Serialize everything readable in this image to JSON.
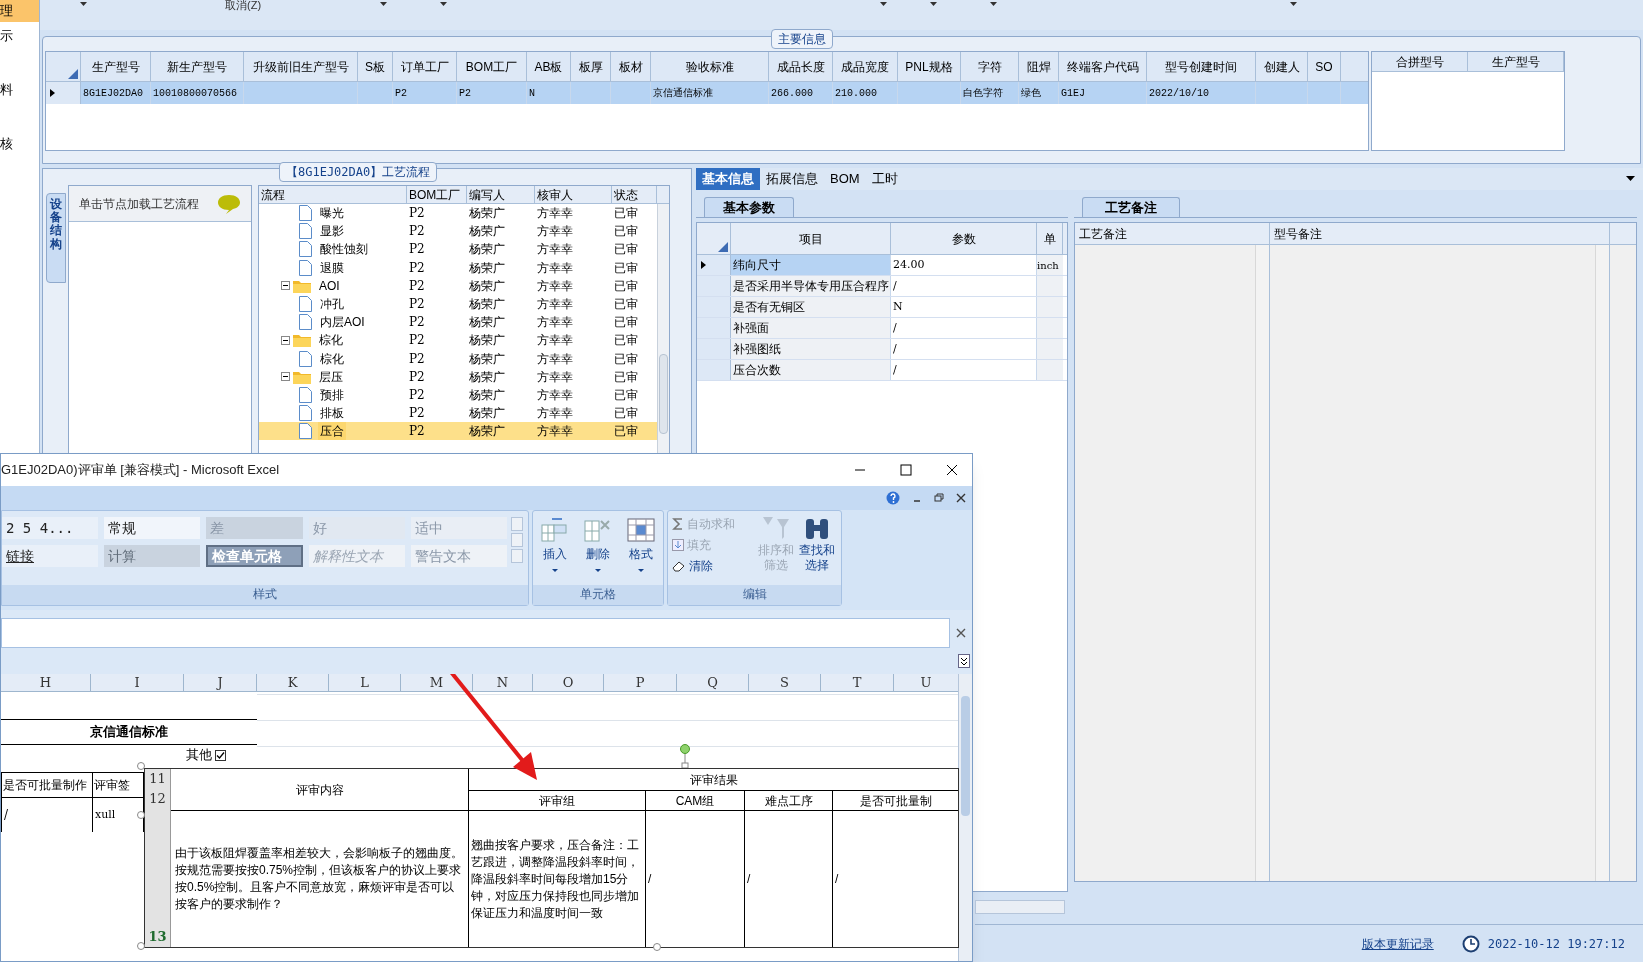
{
  "nav": {
    "items": [
      {
        "label": "理",
        "selected": true
      },
      {
        "label": "示",
        "selected": false
      },
      {
        "label": "料",
        "selected": false
      },
      {
        "label": "核",
        "selected": false
      }
    ]
  },
  "toolbar": {
    "cancel": "取消(Z)"
  },
  "main_info": {
    "title": "主要信息",
    "columns": [
      "生产型号",
      "新生产型号",
      "升级前旧生产型号",
      "S板",
      "订单工厂",
      "BOM工厂",
      "AB板",
      "板厚",
      "板材",
      "验收标准",
      "成品长度",
      "成品宽度",
      "PNL规格",
      "字符",
      "阻焊",
      "终端客户代码",
      "型号创建时间",
      "创建人",
      "SO"
    ],
    "rows": [
      {
        "selected": true,
        "cells": [
          "8G1EJ02DA0",
          "10010800070566",
          null,
          null,
          "P2",
          "P2",
          "N",
          null,
          null,
          "京信通信标准",
          "266.000",
          "210.000",
          null,
          "白色字符",
          "绿色",
          "G1EJ",
          "2022/10/10",
          null,
          null
        ]
      }
    ],
    "merge_columns": [
      "合拼型号",
      "生产型号"
    ]
  },
  "process": {
    "title": "【8G1EJ02DA0】工艺流程",
    "side_tab": "设备结构",
    "hint": "单击节点加载工艺流程",
    "columns": [
      "流程",
      "BOM工厂",
      "编写人",
      "核审人",
      "状态"
    ],
    "nodes": [
      {
        "kind": "leaf",
        "label": "曝光",
        "bom": "P2",
        "writer": "杨荣广",
        "reviewer": "方幸幸",
        "status": "已审",
        "selected": false
      },
      {
        "kind": "leaf",
        "label": "显影",
        "bom": "P2",
        "writer": "杨荣广",
        "reviewer": "方幸幸",
        "status": "已审",
        "selected": false
      },
      {
        "kind": "leaf",
        "label": "酸性蚀刻",
        "bom": "P2",
        "writer": "杨荣广",
        "reviewer": "方幸幸",
        "status": "已审",
        "selected": false
      },
      {
        "kind": "leaf",
        "label": "退膜",
        "bom": "P2",
        "writer": "杨荣广",
        "reviewer": "方幸幸",
        "status": "已审",
        "selected": false
      },
      {
        "kind": "folder",
        "label": "AOI",
        "bom": "P2",
        "writer": "杨荣广",
        "reviewer": "方幸幸",
        "status": "已审",
        "selected": false,
        "expanded": true,
        "children": [
          {
            "kind": "leaf",
            "label": "冲孔",
            "bom": "P2",
            "writer": "杨荣广",
            "reviewer": "方幸幸",
            "status": "已审",
            "selected": false
          },
          {
            "kind": "leaf",
            "label": "内层AOI",
            "bom": "P2",
            "writer": "杨荣广",
            "reviewer": "方幸幸",
            "status": "已审",
            "selected": false
          }
        ]
      },
      {
        "kind": "folder",
        "label": "棕化",
        "bom": "P2",
        "writer": "杨荣广",
        "reviewer": "方幸幸",
        "status": "已审",
        "selected": false,
        "expanded": true,
        "children": [
          {
            "kind": "leaf",
            "label": "棕化",
            "bom": "P2",
            "writer": "杨荣广",
            "reviewer": "方幸幸",
            "status": "已审",
            "selected": false
          }
        ]
      },
      {
        "kind": "folder",
        "label": "层压",
        "bom": "P2",
        "writer": "杨荣广",
        "reviewer": "方幸幸",
        "status": "已审",
        "selected": false,
        "expanded": true,
        "children": [
          {
            "kind": "leaf",
            "label": "预排",
            "bom": "P2",
            "writer": "杨荣广",
            "reviewer": "方幸幸",
            "status": "已审",
            "selected": false
          },
          {
            "kind": "leaf",
            "label": "排板",
            "bom": "P2",
            "writer": "杨荣广",
            "reviewer": "方幸幸",
            "status": "已审",
            "selected": false
          },
          {
            "kind": "leaf",
            "label": "压合",
            "bom": "P2",
            "writer": "杨荣广",
            "reviewer": "方幸幸",
            "status": "已审",
            "selected": true
          }
        ]
      }
    ]
  },
  "detail_tabs": [
    {
      "label": "基本信息",
      "selected": true
    },
    {
      "label": "拓展信息",
      "selected": false
    },
    {
      "label": "BOM",
      "selected": false
    },
    {
      "label": "工时",
      "selected": false
    }
  ],
  "params": {
    "tab": "基本参数",
    "columns": [
      "项目",
      "参数",
      "单"
    ],
    "rows": [
      {
        "item": "纬向尺寸",
        "value": "24.00",
        "unit": "inch",
        "selected": true
      },
      {
        "item": "是否采用半导体专用压合程序",
        "value": "/",
        "selected": false
      },
      {
        "item": "是否有无铜区",
        "value": "N",
        "selected": false
      },
      {
        "item": "补强面",
        "value": "/",
        "selected": false
      },
      {
        "item": "补强图纸",
        "value": "/",
        "selected": false
      },
      {
        "item": "压合次数",
        "value": "/",
        "selected": false
      }
    ]
  },
  "remarks": {
    "tab": "工艺备注",
    "columns": [
      "工艺备注",
      "型号备注"
    ]
  },
  "status_bar": {
    "link": "版本更新记录",
    "time": "2022-10-12 19:27:12"
  },
  "excel": {
    "title": "G1EJ02DA0)评审单  [兼容模式] - Microsoft Excel",
    "styles": [
      {
        "label": "2 5 4...",
        "kind": "plain"
      },
      {
        "label": "常规",
        "kind": "normal"
      },
      {
        "label": "差",
        "kind": "bad"
      },
      {
        "label": "好",
        "kind": "good"
      },
      {
        "label": "适中",
        "kind": "neutral"
      },
      {
        "label": "链接",
        "kind": "link"
      },
      {
        "label": "计算",
        "kind": "calc"
      },
      {
        "label": "检查单元格",
        "kind": "check"
      },
      {
        "label": "解释性文本",
        "kind": "explain"
      },
      {
        "label": "警告文本",
        "kind": "warn"
      }
    ],
    "groups": {
      "styles": "样式",
      "cells": "单元格",
      "editing": "编辑"
    },
    "cell_buttons": [
      "插入",
      "删除",
      "格式"
    ],
    "edit_small": [
      {
        "label": "自动求和",
        "disabled": true
      },
      {
        "label": "填充",
        "disabled": true
      },
      {
        "label": "清除",
        "disabled": false
      }
    ],
    "edit_big": [
      {
        "label": "排序和筛选",
        "disabled": true
      },
      {
        "label": "查找和选择",
        "disabled": false
      }
    ],
    "col_headers": [
      "H",
      "I",
      "J",
      "K",
      "L",
      "M",
      "N",
      "O",
      "P",
      "Q",
      "S",
      "T",
      "U"
    ],
    "cells": {
      "standard": "京信通信标准",
      "other": "其他",
      "other_checked": true,
      "batch": "是否可批量制作",
      "sign": "评审签",
      "value_1": "/",
      "value_2": "xull"
    },
    "picture": {
      "row_numbers": [
        "11",
        "12",
        "13"
      ],
      "content_head": "评审内容",
      "result_head": "评审结果",
      "sub_heads": [
        "评审组",
        "CAM组",
        "难点工序",
        "是否可批量制"
      ],
      "content": "由于该板阻焊覆盖率相差较大，会影响板子的翘曲度。按规范需要按按0.75%控制，但该板客户的协议上要求按0.5%控制。且客户不同意放宽，麻烦评审是否可以按客户的要求制作？",
      "results": [
        "翘曲按客户要求，压合备注：工艺跟进，调整降温段斜率时间，降温段斜率时间每段增加15分钟，对应压力保持段也同步增加保证压力和温度时间一致",
        "/",
        "/",
        "/"
      ]
    }
  }
}
